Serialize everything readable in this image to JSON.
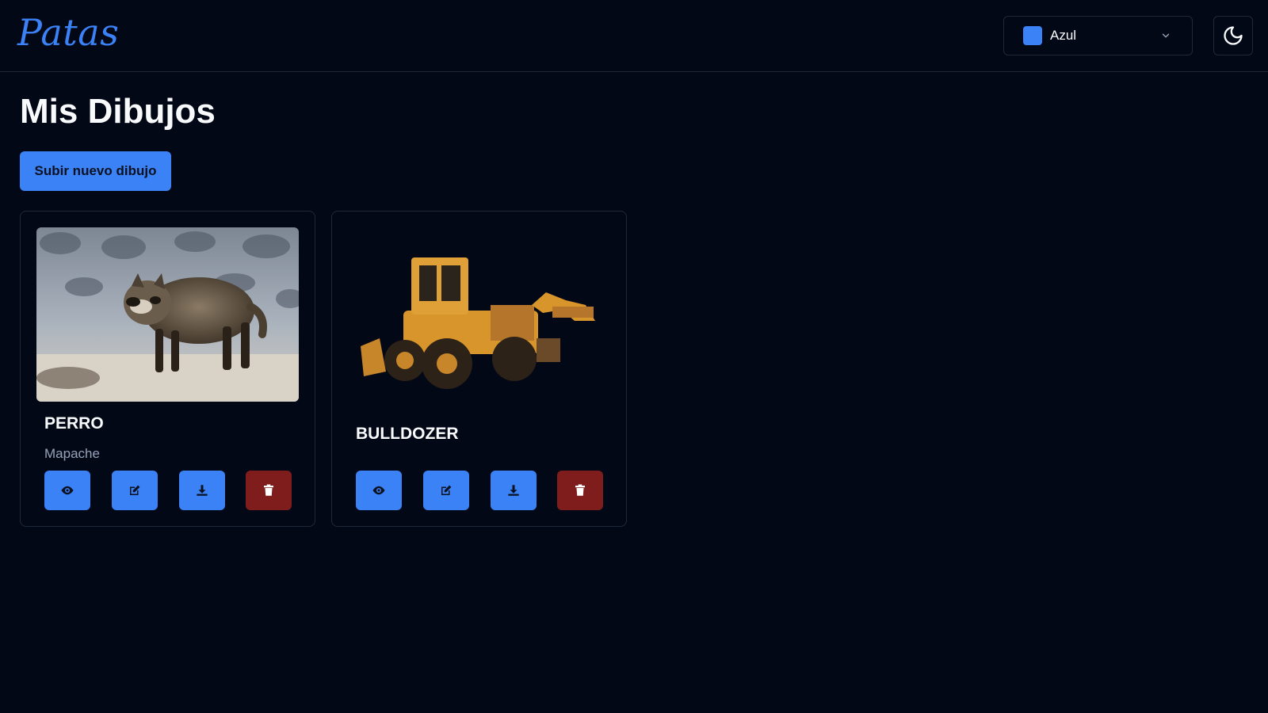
{
  "app": {
    "logo": "Patas"
  },
  "header": {
    "theme_select": {
      "value": "Azul",
      "swatch_color": "#3b82f6"
    },
    "dark_toggle_icon": "moon-icon"
  },
  "main": {
    "title": "Mis Dibujos",
    "upload_button": "Subir nuevo dibujo"
  },
  "drawings": [
    {
      "title": "PERRO",
      "description": "Mapache",
      "image": "raccoon-dog photo",
      "actions": [
        "view-icon",
        "edit-icon",
        "download-icon",
        "delete-icon"
      ]
    },
    {
      "title": "BULLDOZER",
      "description": "",
      "image": "orange bulldozer/loader photo",
      "actions": [
        "view-icon",
        "edit-icon",
        "download-icon",
        "delete-icon"
      ]
    }
  ],
  "colors": {
    "background": "#030817",
    "accent": "#3b82f6",
    "danger": "#7f1d1d",
    "border": "#1e293b",
    "muted_text": "#94a3b8"
  }
}
